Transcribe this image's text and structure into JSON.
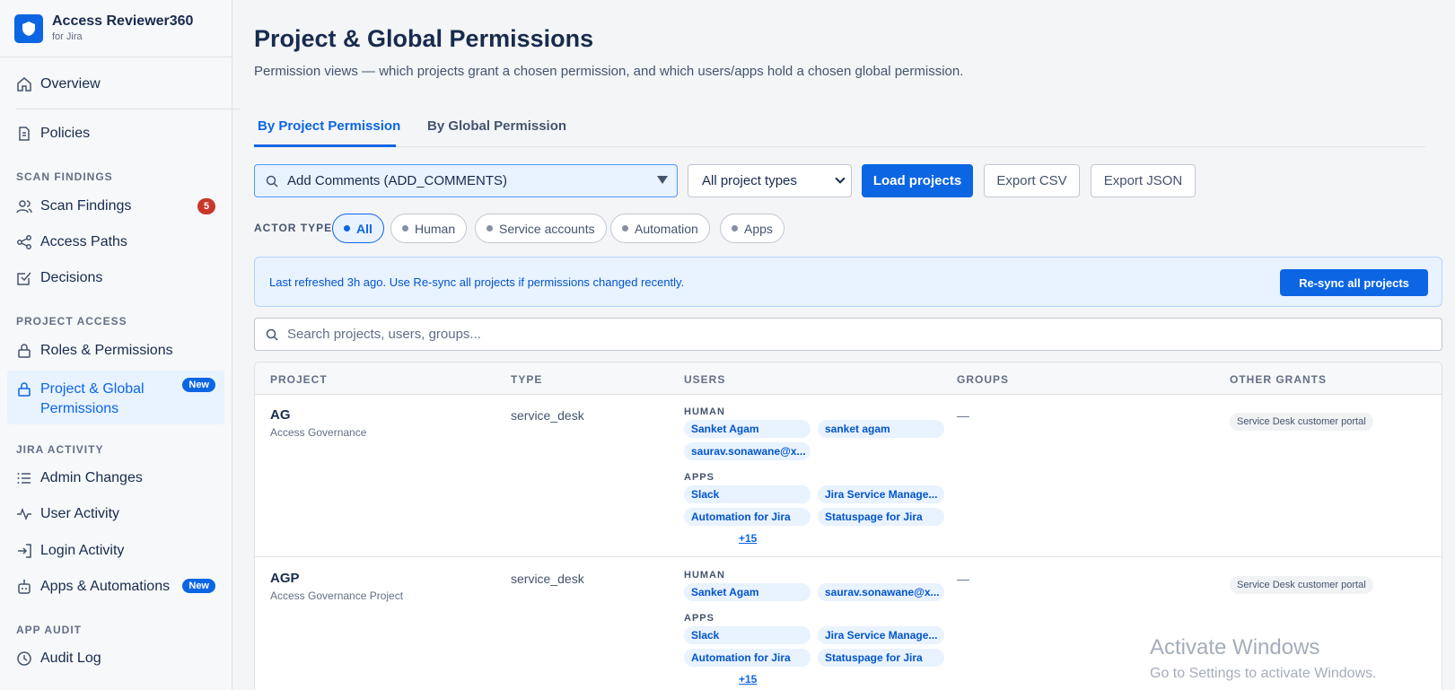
{
  "brand": {
    "title": "Access Reviewer360",
    "subtitle": "for Jira"
  },
  "sidebar": {
    "overview": "Overview",
    "policies": "Policies",
    "sections": {
      "scan_findings": "SCAN FINDINGS",
      "project_access": "PROJECT ACCESS",
      "jira_activity": "JIRA ACTIVITY",
      "app_audit": "APP AUDIT"
    },
    "scan_findings": "Scan Findings",
    "scan_findings_count": "5",
    "access_paths": "Access Paths",
    "decisions": "Decisions",
    "roles_permissions": "Roles & Permissions",
    "project_global_line1": "Project & Global",
    "project_global_line2": "Permissions",
    "new_badge": "New",
    "admin_changes": "Admin Changes",
    "user_activity": "User Activity",
    "login_activity": "Login Activity",
    "apps_automations": "Apps & Automations",
    "audit_log": "Audit Log"
  },
  "page": {
    "title": "Project & Global Permissions",
    "description": "Permission views — which projects grant a chosen permission, and which users/apps hold a chosen global permission."
  },
  "tabs": {
    "by_project": "By Project Permission",
    "by_global": "By Global Permission"
  },
  "controls": {
    "permission_selected": "Add Comments (ADD_COMMENTS)",
    "project_type_selected": "All project types",
    "load_projects": "Load projects",
    "export_csv": "Export CSV",
    "export_json": "Export JSON"
  },
  "actor_filter": {
    "label": "ACTOR TYPE",
    "options": [
      "All",
      "Human",
      "Service accounts",
      "Automation",
      "Apps"
    ]
  },
  "banner": {
    "text": "Last refreshed 3h ago. Use Re-sync all projects if permissions changed recently.",
    "button": "Re-sync all projects"
  },
  "search": {
    "placeholder": "Search projects, users, groups..."
  },
  "table": {
    "headers": {
      "project": "PROJECT",
      "type": "TYPE",
      "users": "USERS",
      "groups": "GROUPS",
      "other_grants": "OTHER GRANTS"
    },
    "human_label": "HUMAN",
    "apps_label": "APPS",
    "rows": [
      {
        "key": "AG",
        "name": "Access Governance",
        "type": "service_desk",
        "humans": [
          "Sanket Agam",
          "sanket agam",
          "saurav.sonawane@x..."
        ],
        "apps": [
          "Slack",
          "Jira Service Manage...",
          "Automation for Jira",
          "Statuspage for Jira"
        ],
        "more": "+15",
        "groups": "—",
        "other_grant": "Service Desk customer portal"
      },
      {
        "key": "AGP",
        "name": "Access Governance Project",
        "type": "service_desk",
        "humans": [
          "Sanket Agam",
          "saurav.sonawane@x..."
        ],
        "apps": [
          "Slack",
          "Jira Service Manage...",
          "Automation for Jira",
          "Statuspage for Jira"
        ],
        "more": "+15",
        "groups": "—",
        "other_grant": "Service Desk customer portal"
      }
    ]
  },
  "watermark": {
    "line1": "Activate Windows",
    "line2": "Go to Settings to activate Windows."
  }
}
